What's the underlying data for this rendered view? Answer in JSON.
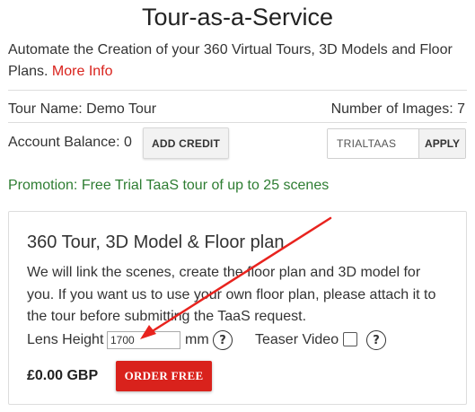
{
  "header": {
    "title": "Tour-as-a-Service"
  },
  "intro": {
    "text": "Automate the Creation of your 360 Virtual Tours, 3D Models and Floor Plans.",
    "link_label": "More Info"
  },
  "tour": {
    "name_label": "Tour Name: Demo Tour",
    "images_label": "Number of Images: 7"
  },
  "account": {
    "balance_label": "Account Balance: 0",
    "add_credit_label": "ADD CREDIT",
    "coupon_value": "TRIALTAAS",
    "apply_label": "APPLY"
  },
  "promotion": {
    "text": "Promotion: Free Trial TaaS tour of up to 25 scenes"
  },
  "product": {
    "title": "360 Tour, 3D Model & Floor plan",
    "description": "We will link the scenes, create the floor plan and 3D model for you. If you want us to use your own floor plan, please attach it to the tour before submitting the TaaS request.",
    "lens_height_label": "Lens Height",
    "lens_height_value": "1700",
    "lens_unit": "mm",
    "help_glyph": "?",
    "teaser_label": "Teaser Video",
    "teaser_checked": false,
    "price": "£0.00 GBP",
    "order_label": "ORDER FREE"
  },
  "icons": {
    "help": "help-circle-icon",
    "annotation": "red-arrow-annotation"
  },
  "colors": {
    "accent_red": "#d9221c",
    "promo_green": "#2e7d32",
    "border": "#dddddd"
  }
}
